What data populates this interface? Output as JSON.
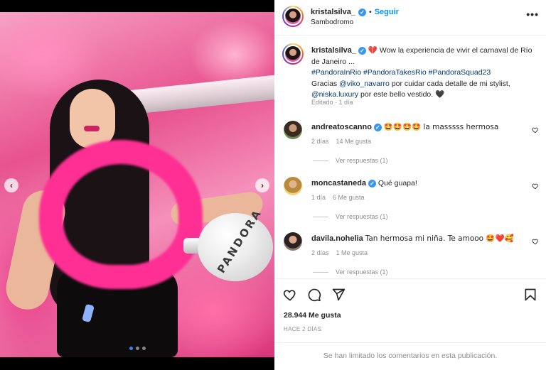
{
  "post": {
    "username": "kristalsilva_",
    "follow_label": "Seguir",
    "separator": "•",
    "location": "Sambodromo",
    "more_icon": "more-horizontal-icon",
    "balloon_text": "PANDORA",
    "carousel": {
      "count": 3,
      "active": 1
    }
  },
  "caption": {
    "username": "kristalsilva_",
    "emoji": "💔",
    "text": "Wow la experiencia de vivir el carnaval de Río de Janeiro ...",
    "hashtags": [
      "#PandoraInRio",
      "#PandoraTakesRio",
      "#PandoraSquad23"
    ],
    "thanks_prefix": "Gracias",
    "mention1": "@viko_navarro",
    "thanks_middle": "por cuidar cada detalle de mi stylist,",
    "mention2": "@niska.luxury",
    "thanks_suffix": "por este bello vestido.",
    "end_emoji": "🖤",
    "edited": "Editado",
    "time": "1 día"
  },
  "comments": [
    {
      "username": "andreatoscanno",
      "verified": true,
      "text": "🤩🤩🤩🤩 la masssss hermosa",
      "time": "2 días",
      "likes": "14 Me gusta",
      "replies": "Ver respuestas (1)"
    },
    {
      "username": "moncastaneda",
      "verified": true,
      "text": "Qué guapa!",
      "time": "1 día",
      "likes": "6 Me gusta",
      "replies": "Ver respuestas (1)"
    },
    {
      "username": "davila.nohelia",
      "verified": false,
      "text": "Tan hermosa mi niña. Te amooo 🤩❤️🥰",
      "time": "2 días",
      "likes": "1 Me gusta",
      "replies": "Ver respuestas (1)"
    }
  ],
  "footer": {
    "likes": "28.944 Me gusta",
    "posted": "HACE 2 DÍAS",
    "limited": "Se han limitado los comentarios en esta publicación."
  },
  "icons": {
    "like": "heart-icon",
    "comment": "comment-icon",
    "share": "share-icon",
    "save": "bookmark-icon"
  },
  "colors": {
    "link": "#0095f6",
    "hashtag": "#00376b",
    "muted": "#8e8e8e",
    "verified": "#3897f0"
  }
}
